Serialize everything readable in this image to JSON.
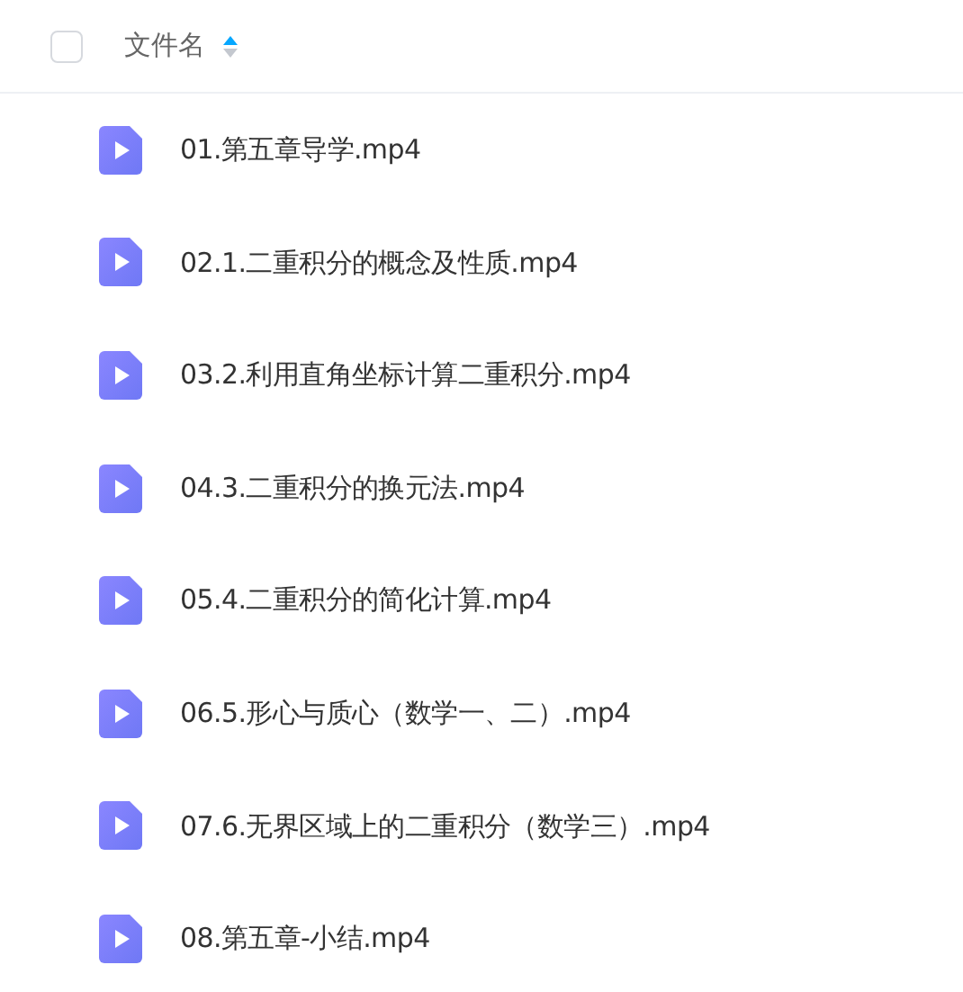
{
  "header": {
    "select_all_checked": false,
    "column_label": "文件名",
    "sort_ascending": true
  },
  "files": [
    {
      "name": "01.第五章导学.mp4"
    },
    {
      "name": "02.1.二重积分的概念及性质.mp4"
    },
    {
      "name": "03.2.利用直角坐标计算二重积分.mp4"
    },
    {
      "name": "04.3.二重积分的换元法.mp4"
    },
    {
      "name": "05.4.二重积分的简化计算.mp4"
    },
    {
      "name": "06.5.形心与质心（数学一、二）.mp4"
    },
    {
      "name": "07.6.无界区域上的二重积分（数学三）.mp4"
    },
    {
      "name": "08.第五章-小结.mp4"
    }
  ]
}
